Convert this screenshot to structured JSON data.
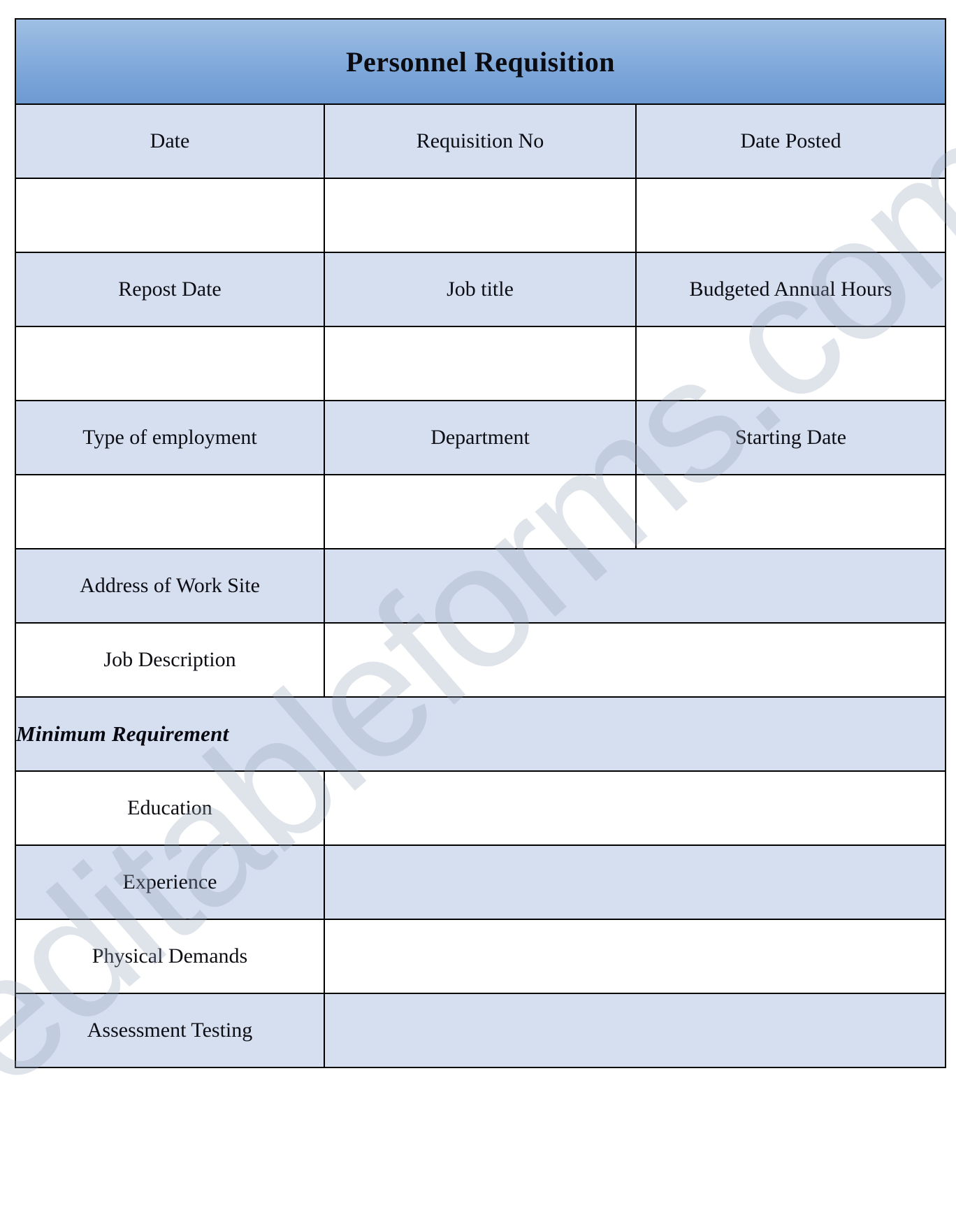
{
  "document": {
    "title": "Personnel Requisition",
    "watermark": "editableforms.com"
  },
  "colors": {
    "title_banner_top": "#9fc0e4",
    "title_banner_bottom": "#6e9ad3",
    "label_cell_fill": "#d6dff0",
    "input_cell_fill": "#ffffff",
    "border": "#000000",
    "text": "#0d0d14",
    "watermark": "#96a3b9"
  },
  "rows": {
    "row1_labels": {
      "col1": "Date",
      "col2": "Requisition No",
      "col3": "Date Posted"
    },
    "row1_values": {
      "col1": "",
      "col2": "",
      "col3": ""
    },
    "row2_labels": {
      "col1": "Repost Date",
      "col2": "Job title",
      "col3": "Budgeted Annual Hours"
    },
    "row2_values": {
      "col1": "",
      "col2": "",
      "col3": ""
    },
    "row3_labels": {
      "col1": "Type of employment",
      "col2": "Department",
      "col3": "Starting Date"
    },
    "row3_values": {
      "col1": "",
      "col2": "",
      "col3": ""
    },
    "address": {
      "label": "Address of Work Site",
      "value": ""
    },
    "job_description": {
      "label": "Job Description",
      "value": ""
    },
    "minimum_requirement": {
      "heading": "Minimum Requirement",
      "items": [
        {
          "label": "Education",
          "value": ""
        },
        {
          "label": "Experience",
          "value": ""
        },
        {
          "label": "Physical Demands",
          "value": ""
        },
        {
          "label": "Assessment Testing",
          "value": ""
        }
      ]
    }
  }
}
